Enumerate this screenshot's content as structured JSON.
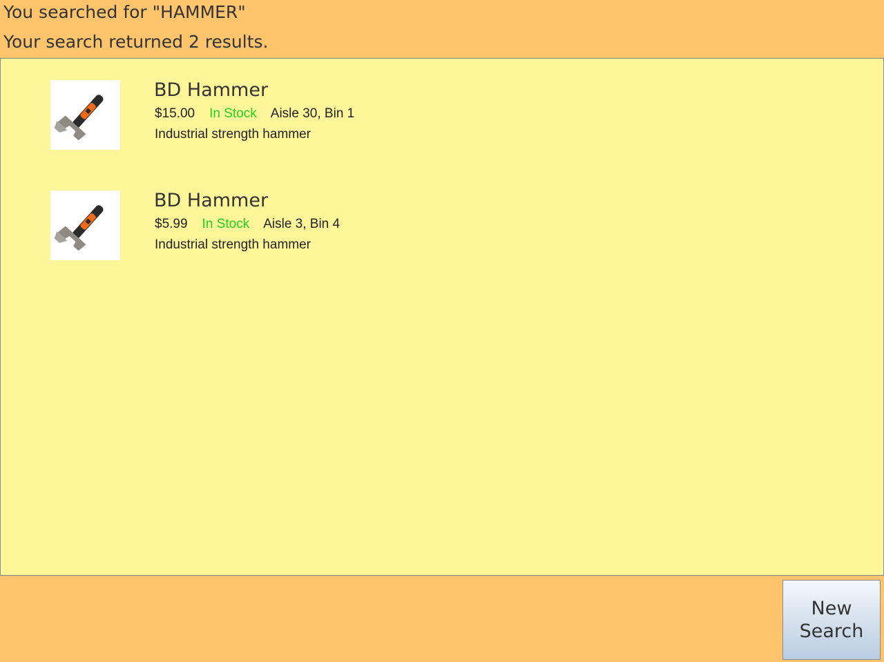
{
  "header": {
    "search_line": "You searched for \"HAMMER\"",
    "results_line": "Your search returned 2 results."
  },
  "results": [
    {
      "name": "BD Hammer",
      "price": "$15.00",
      "stock": "In Stock",
      "location": "Aisle 30, Bin 1",
      "description": "Industrial strength hammer",
      "image_icon": "hammer-icon"
    },
    {
      "name": "BD Hammer",
      "price": "$5.99",
      "stock": "In Stock",
      "location": "Aisle 3, Bin 4",
      "description": "Industrial strength hammer",
      "image_icon": "hammer-icon"
    }
  ],
  "footer": {
    "new_search_line1": "New",
    "new_search_line2": "Search"
  },
  "colors": {
    "page_background": "#ffc46c",
    "results_background": "#fff69a",
    "in_stock": "#1ed41e"
  }
}
